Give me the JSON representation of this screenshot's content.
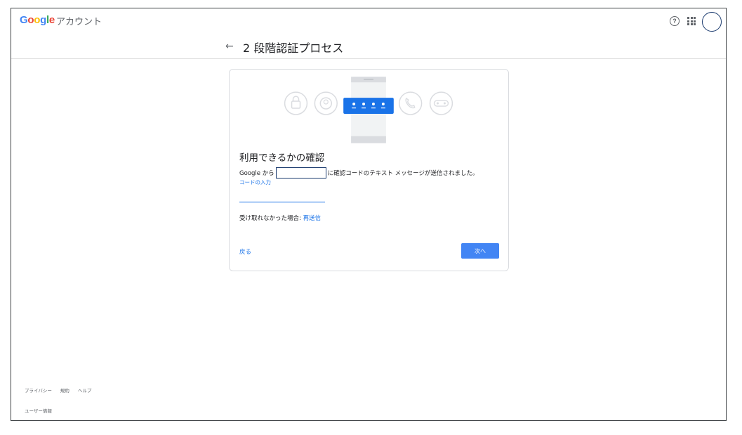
{
  "header": {
    "logo": [
      "G",
      "o",
      "o",
      "g",
      "l",
      "e"
    ],
    "product": "アカウント",
    "help_glyph": "?"
  },
  "title": {
    "text": "2 段階認証プロセス"
  },
  "card": {
    "heading": "利用できるかの確認",
    "desc_prefix": "Google から",
    "desc_suffix": "に確認コードのテキスト メッセージが送信されました。",
    "code_label": "コードの入力",
    "code_value": "",
    "resend_prefix": "受け取れなかった場合: ",
    "resend_link": "再送信",
    "back": "戻る",
    "next": "次へ"
  },
  "footer": {
    "links": [
      "プライバシー",
      "規約",
      "ヘルプ"
    ],
    "user_info": "ユーザー情報"
  },
  "colors": {
    "accent": "#4285f4",
    "link": "#1a73e8"
  },
  "icons": [
    "lock-icon",
    "account-icon",
    "password-dots-icon",
    "phone-icon",
    "key-icon"
  ]
}
